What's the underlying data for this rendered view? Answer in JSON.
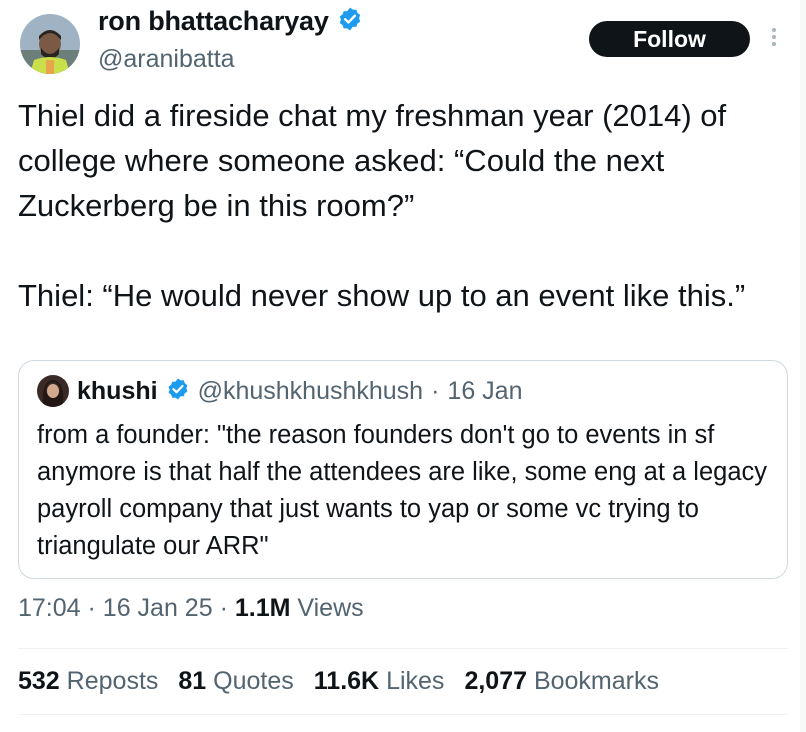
{
  "author": {
    "name": "ron bhattacharyay",
    "handle": "@aranibatta",
    "verified": true
  },
  "follow_label": "Follow",
  "tweet": {
    "paragraphs": [
      "Thiel did a fireside chat my freshman year (2014) of college where someone asked: “Could the next Zuckerberg be in this room?”",
      "Thiel: “He would never show up to an event like this.”"
    ]
  },
  "quoted": {
    "name": "khushi",
    "handle": "@khushkhushkhush",
    "separator": "·",
    "date": "16 Jan",
    "text": "from a founder: \"the reason founders don't go to events in sf anymore is that half the attendees are like, some eng at a legacy payroll company that just wants to yap or some vc trying to triangulate our ARR\""
  },
  "meta": {
    "time": "17:04",
    "separator": "·",
    "date": "16 Jan 25",
    "views_count": "1.1M",
    "views_label": "Views"
  },
  "stats": [
    {
      "count": "532",
      "label": "Reposts"
    },
    {
      "count": "81",
      "label": "Quotes"
    },
    {
      "count": "11.6K",
      "label": "Likes"
    },
    {
      "count": "2,077",
      "label": "Bookmarks"
    }
  ],
  "colors": {
    "verified": "#1d9bf0",
    "follow_bg": "#0f1419",
    "secondary_text": "#536471",
    "border": "#cfd9de"
  }
}
